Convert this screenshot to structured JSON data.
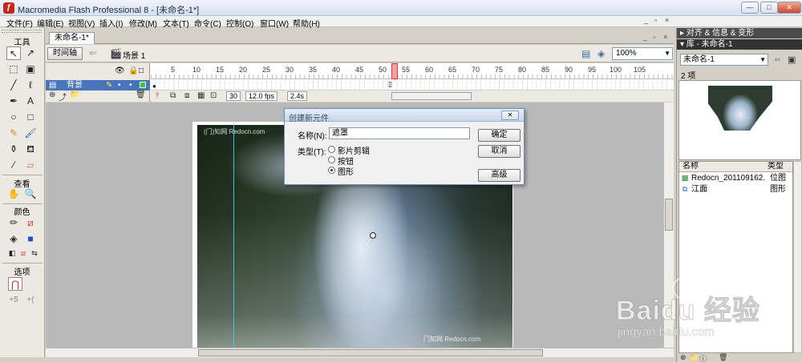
{
  "window": {
    "title": "Macromedia Flash Professional 8 - [未命名-1*]",
    "minimize": "—",
    "maximize": "□",
    "close": "✕"
  },
  "menu": {
    "items": [
      "文件(F)",
      "编辑(E)",
      "视图(V)",
      "插入(I)",
      "修改(M)",
      "文本(T)",
      "命令(C)",
      "控制(O)",
      "窗口(W)",
      "帮助(H)"
    ],
    "doc_controls": [
      "_",
      "▫",
      "×"
    ]
  },
  "tools": {
    "title": "工具",
    "view_title": "查看",
    "color_title": "颜色",
    "options_title": "选项"
  },
  "document": {
    "tab_label": "未命名-1*",
    "timeline_button": "时间轴",
    "scene_label": "场景 1",
    "zoom": "100%"
  },
  "timeline": {
    "ruler_labels": [
      "5",
      "10",
      "15",
      "20",
      "25",
      "30",
      "35",
      "40",
      "45",
      "50",
      "55",
      "60",
      "65",
      "70",
      "75",
      "80",
      "85",
      "90",
      "95",
      "100",
      "105"
    ],
    "layer_name": "背景",
    "current_frame": "30",
    "frame_rate": "12.0 fps",
    "elapsed_time": "2.4s"
  },
  "stage": {
    "watermark_top": "(门)知网 Redocn.com",
    "watermark_bottom": "门知网 Redocn.com"
  },
  "dialog": {
    "title": "创建新元件",
    "name_label": "名称(N):",
    "name_value": "遮罩",
    "type_label": "类型(T):",
    "options": [
      {
        "label": "影片剪辑",
        "checked": false
      },
      {
        "label": "按钮",
        "checked": false
      },
      {
        "label": "图形",
        "checked": true
      }
    ],
    "ok_button": "确定",
    "cancel_button": "取消",
    "advanced_button": "高级"
  },
  "right_panel": {
    "align_header": "▸ 对齐 & 信息 & 变形",
    "library_header": "▾ 库 - 未命名-1",
    "library_select": "未命名-1",
    "item_count": "2 项",
    "col_name": "名称",
    "col_type": "类型",
    "items": [
      {
        "name": "Redocn_201109162...",
        "type": "位图"
      },
      {
        "name": "江面",
        "type": "图形"
      }
    ]
  },
  "watermark": {
    "brand": "Baidu 经验",
    "url": "jingyan.baidu.com"
  },
  "colors": {
    "layer_selected": "#4a74b9",
    "playhead": "#d04040",
    "guide": "#3cc7d8"
  }
}
